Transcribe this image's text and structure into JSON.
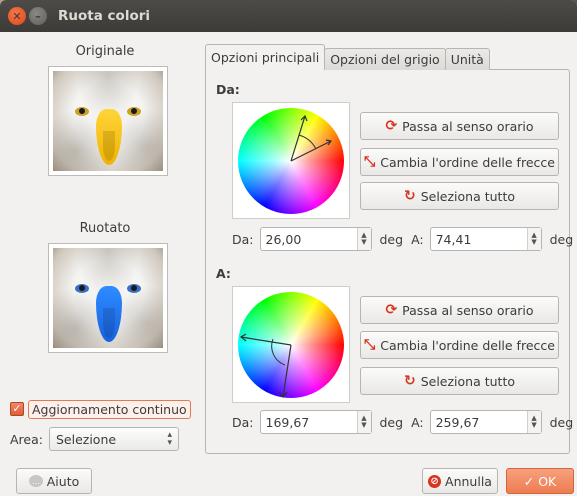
{
  "window": {
    "title": "Ruota colori"
  },
  "left": {
    "original_label": "Originale",
    "rotated_label": "Ruotato",
    "continuous_update": {
      "label": "Aggiornamento continuo",
      "checked": true
    },
    "area": {
      "label": "Area:",
      "value": "Selezione"
    }
  },
  "tabs": [
    {
      "label": "Opzioni principali",
      "active": true
    },
    {
      "label": "Opzioni del grigio",
      "active": false
    },
    {
      "label": "Unità",
      "active": false
    }
  ],
  "from_section": {
    "title": "Da:",
    "buttons": {
      "clockwise": "Passa al senso orario",
      "swap": "Cambia l'ordine delle frecce",
      "select_all": "Seleziona tutto"
    },
    "from_label": "Da:",
    "from_value": "26,00",
    "to_label": "A:",
    "to_value": "74,41",
    "unit": "deg"
  },
  "to_section": {
    "title": "A:",
    "buttons": {
      "clockwise": "Passa al senso orario",
      "swap": "Cambia l'ordine delle frecce",
      "select_all": "Seleziona tutto"
    },
    "from_label": "Da:",
    "from_value": "169,67",
    "to_label": "A:",
    "to_value": "259,67",
    "unit": "deg"
  },
  "footer": {
    "help": "Aiuto",
    "cancel": "Annulla",
    "ok": "OK"
  },
  "icons": {
    "close": "close-icon",
    "minimize": "minimize-icon",
    "clockwise": "rotate-cw-icon",
    "swap": "swap-arrows-icon",
    "select_all": "select-all-icon",
    "help": "help-icon",
    "cancel": "cancel-icon",
    "ok": "checkmark-icon"
  },
  "colors": {
    "accent": "#ee7c51",
    "titlebar": "#3c3b37",
    "icon_red": "#d9341f"
  }
}
